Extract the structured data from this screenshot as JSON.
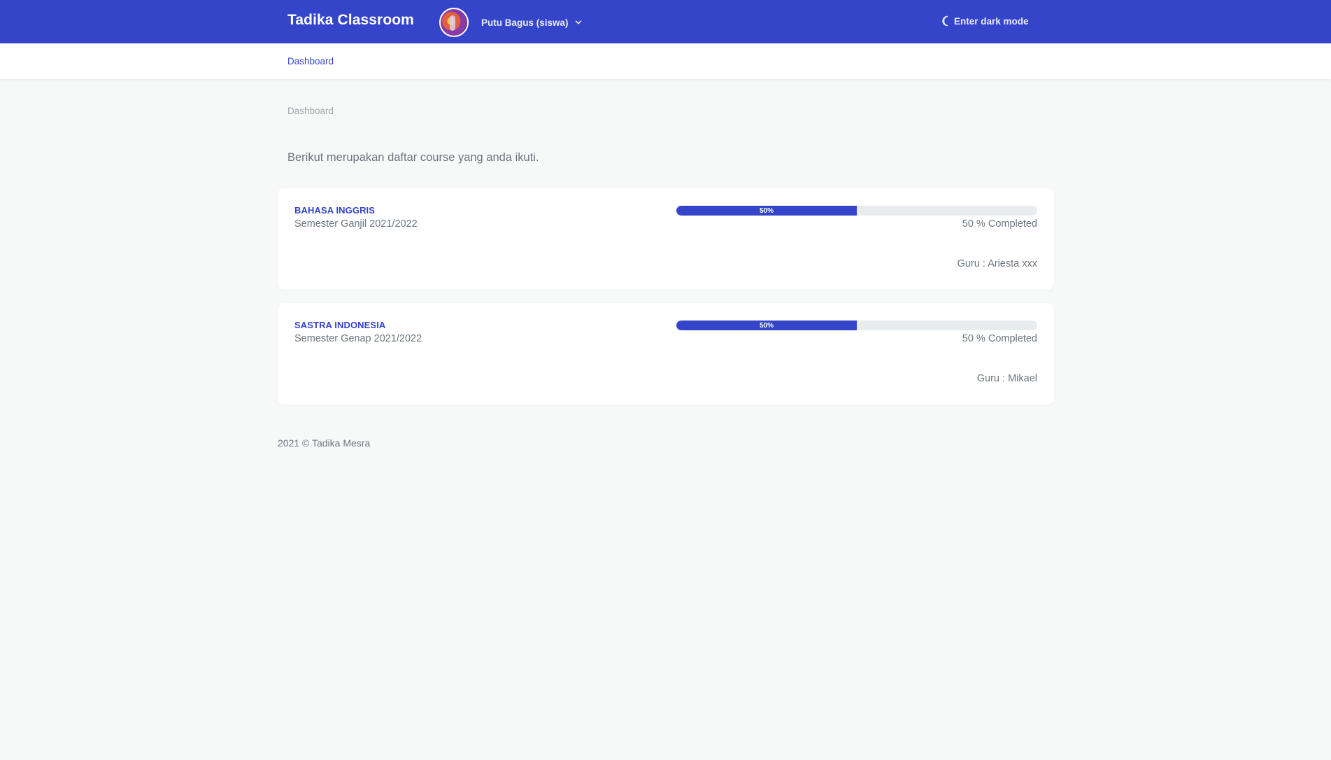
{
  "header": {
    "brand": "Tadika Classroom",
    "user_name": "Putu Bagus (siswa)",
    "dark_mode_label": "Enter dark mode",
    "accent_color": "#3545c9"
  },
  "subnav": {
    "dashboard_label": "Dashboard"
  },
  "breadcrumb": "Dashboard",
  "intro_text": "Berikut merupakan daftar course yang anda ikuti.",
  "courses": [
    {
      "title": "BAHASA INGGRIS",
      "semester": "Semester Ganjil 2021/2022",
      "progress": 50,
      "progress_label": "50%",
      "completed_label": "50 % Completed",
      "teacher": "Guru : Ariesta xxx"
    },
    {
      "title": "SASTRA INDONESIA",
      "semester": "Semester Genap 2021/2022",
      "progress": 50,
      "progress_label": "50%",
      "completed_label": "50 % Completed",
      "teacher": "Guru : Mikael"
    }
  ],
  "footer": "2021 © Tadika Mesra"
}
